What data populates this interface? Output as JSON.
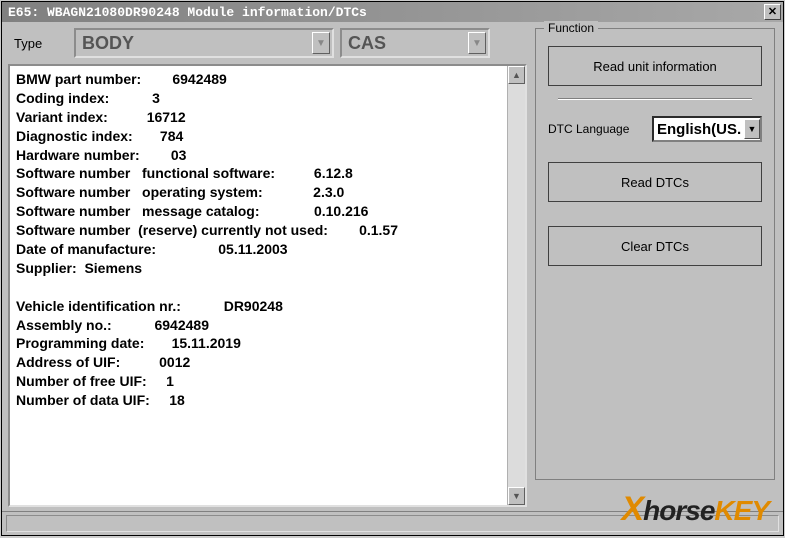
{
  "title": "E65: WBAGN21080DR90248 Module information/DTCs",
  "close_symbol": "✕",
  "type": {
    "label": "Type",
    "value_main": "BODY",
    "value_sub": "CAS"
  },
  "info_rows": [
    {
      "label": "BMW part number:",
      "value": "6942489",
      "pad": 24
    },
    {
      "label": "Coding index:",
      "value": "3",
      "pad": 24
    },
    {
      "label": "Variant index:",
      "value": "16712",
      "pad": 24
    },
    {
      "label": "Diagnostic index:",
      "value": "784",
      "pad": 24
    },
    {
      "label": "Hardware number:",
      "value": "03",
      "pad": 24
    },
    {
      "label": "Software number   functional software:",
      "value": "6.12.8",
      "pad": 48
    },
    {
      "label": "Software number   operating system:",
      "value": "2.3.0",
      "pad": 48
    },
    {
      "label": "Software number   message catalog:",
      "value": "0.10.216",
      "pad": 48
    },
    {
      "label": "Software number  (reserve) currently not used:",
      "value": "0.1.57",
      "pad": 54
    },
    {
      "label": "Date of manufacture:",
      "value": "05.11.2003",
      "pad": 36
    },
    {
      "label": "Supplier:  Siemens",
      "value": "",
      "pad": 0
    },
    {
      "label": "",
      "value": "",
      "pad": 0
    },
    {
      "label": "Vehicle identification nr.:",
      "value": "DR90248",
      "pad": 38
    },
    {
      "label": "Assembly no.:",
      "value": "6942489",
      "pad": 24
    },
    {
      "label": "Programming date:",
      "value": "15.11.2019",
      "pad": 24
    },
    {
      "label": "Address of UIF:",
      "value": "0012",
      "pad": 25
    },
    {
      "label": "Number of free UIF:",
      "value": "1",
      "pad": 24
    },
    {
      "label": "Number of data UIF:",
      "value": "18",
      "pad": 24
    }
  ],
  "function": {
    "legend": "Function",
    "read_unit": "Read unit information",
    "dtc_lang_label": "DTC Language",
    "dtc_lang_value": "English(US.",
    "read_dtcs": "Read DTCs",
    "clear_dtcs": "Clear DTCs"
  },
  "watermark": {
    "x": "X",
    "horse": "horse",
    "key": "KEY"
  }
}
